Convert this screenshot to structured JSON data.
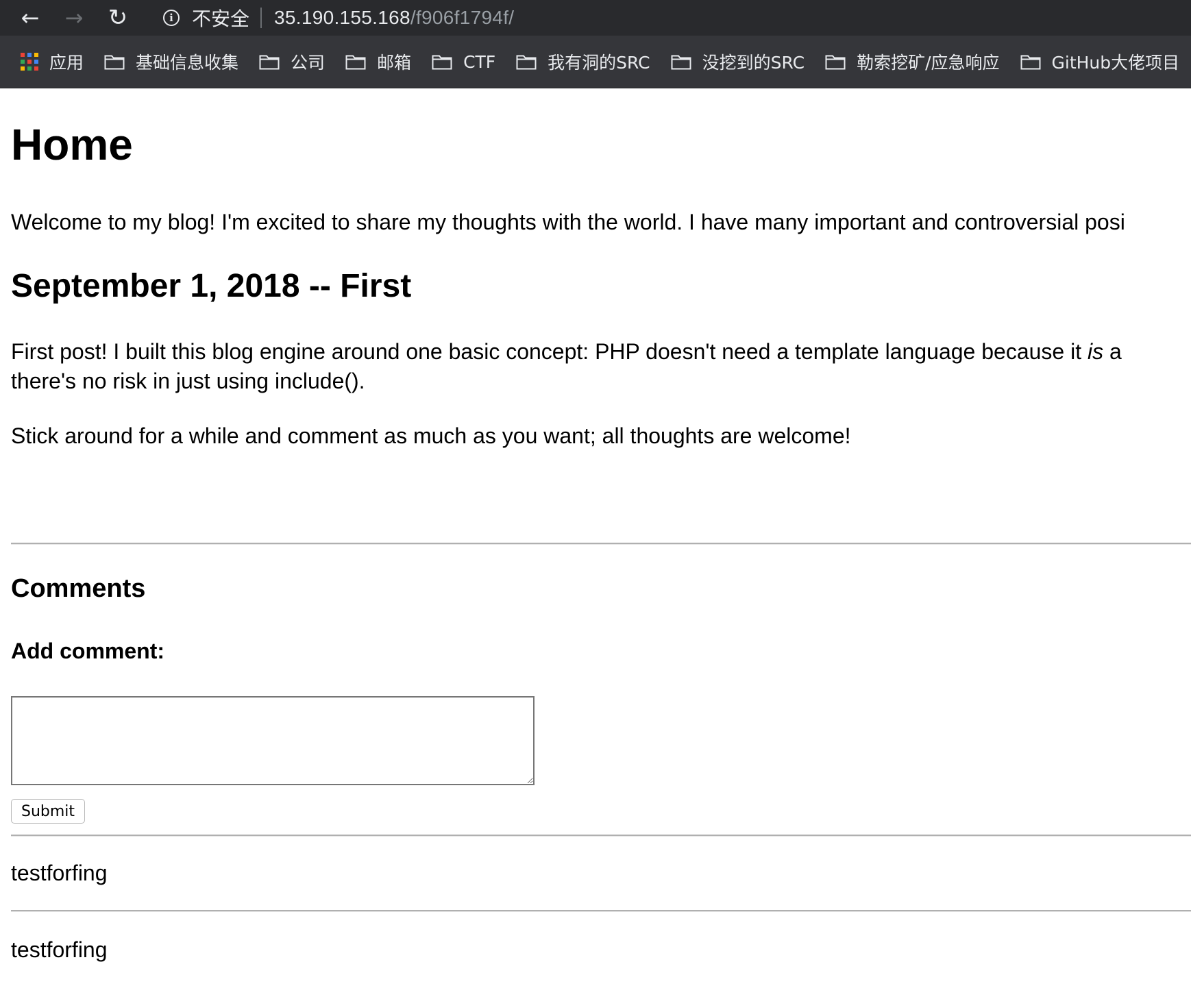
{
  "browser": {
    "security_label": "不安全",
    "url_host": "35.190.155.168",
    "url_path": "/f906f1794f/",
    "bookmarks": {
      "apps": "应用",
      "items": [
        {
          "label": "基础信息收集"
        },
        {
          "label": "公司"
        },
        {
          "label": "邮箱"
        },
        {
          "label": "CTF"
        },
        {
          "label": "我有洞的SRC"
        },
        {
          "label": "没挖到的SRC"
        },
        {
          "label": "勒索挖矿/应急响应"
        },
        {
          "label": "GitHub大佬项目"
        }
      ]
    }
  },
  "page": {
    "title": "Home",
    "intro": "Welcome to my blog! I'm excited to share my thoughts with the world. I have many important and controversial posi",
    "post": {
      "title": "September 1, 2018 -- First",
      "p1_before": "First post! I built this blog engine around one basic concept: PHP doesn't need a template language because it ",
      "p1_em": "is",
      "p1_after": " a",
      "p1_line2": "there's no risk in just using include().",
      "p2": "Stick around for a while and comment as much as you want; all thoughts are welcome!"
    },
    "comments": {
      "title": "Comments",
      "add_label": "Add comment:",
      "textarea_value": "",
      "submit_label": "Submit",
      "items": [
        {
          "text": "testforfing"
        },
        {
          "text": "testforfing"
        }
      ]
    }
  }
}
